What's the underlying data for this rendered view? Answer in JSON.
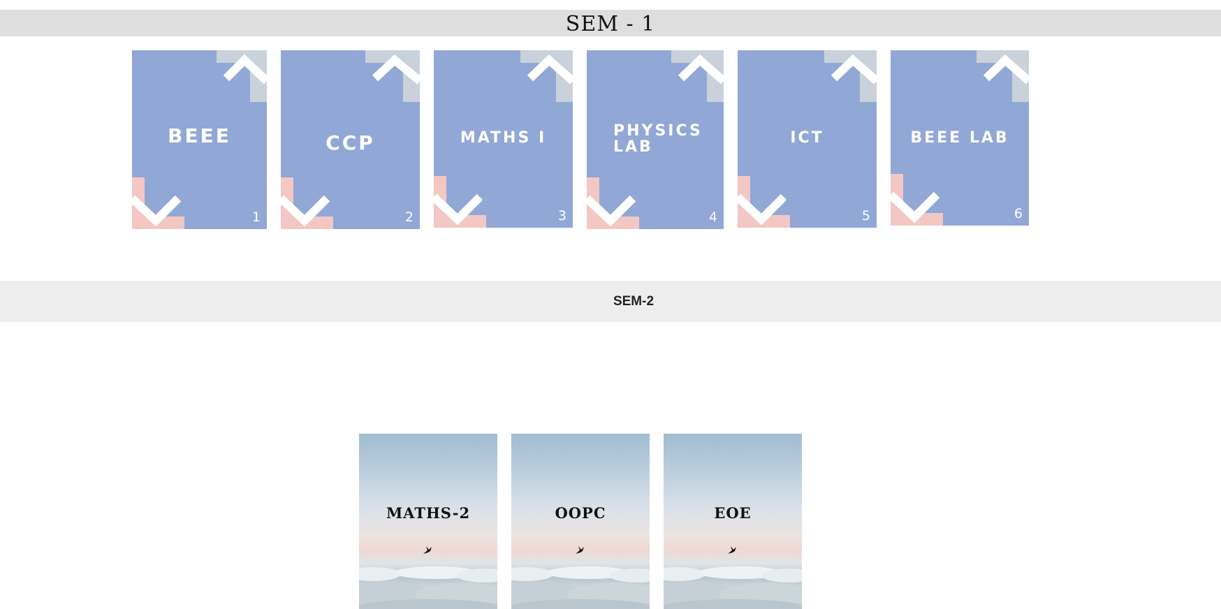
{
  "sem1": {
    "title": "SEM - 1",
    "cards": [
      {
        "label": "BEEE",
        "number": "1"
      },
      {
        "label": "CCP",
        "number": "2"
      },
      {
        "label": "MATHS I",
        "number": "3"
      },
      {
        "label": "PHYSICS LAB",
        "number": "4"
      },
      {
        "label": "ICT",
        "number": "5"
      },
      {
        "label": "BEEE LAB",
        "number": "6"
      }
    ]
  },
  "sem2": {
    "title": "SEM-2",
    "cards": [
      {
        "label": "MATHS-2"
      },
      {
        "label": "OOPC"
      },
      {
        "label": "EOE"
      }
    ]
  },
  "colors": {
    "card_blue": "#91a7d6",
    "accent_grey": "#c9d2da",
    "accent_pink": "#f2c7c4"
  }
}
